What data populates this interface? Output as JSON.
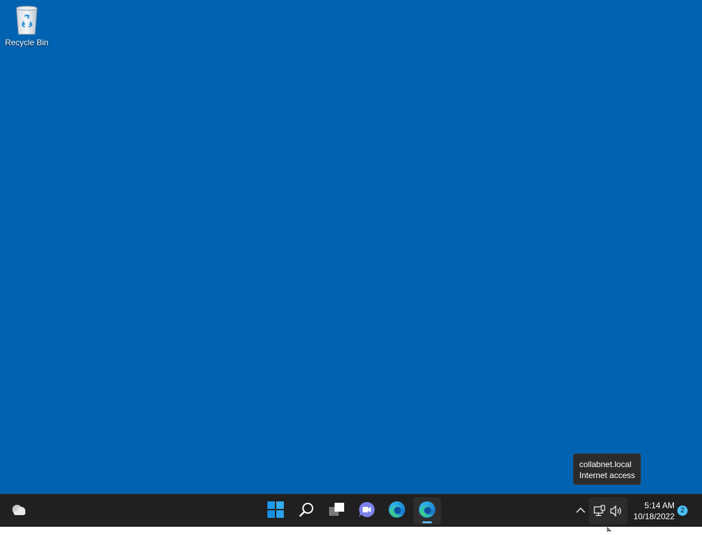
{
  "desktop": {
    "background_color": "#0063b1",
    "icons": [
      {
        "label": "Recycle Bin",
        "icon": "recycle-bin-icon"
      }
    ]
  },
  "tooltip": {
    "line1": "collabnet.local",
    "line2": "Internet access"
  },
  "taskbar": {
    "background_color": "#202020",
    "widgets_icon": "weather-cloud-icon",
    "center_items": [
      {
        "name": "start",
        "icon": "windows-start-icon"
      },
      {
        "name": "search",
        "icon": "search-icon"
      },
      {
        "name": "task-view",
        "icon": "task-view-icon"
      },
      {
        "name": "chat",
        "icon": "teams-chat-icon"
      },
      {
        "name": "edge",
        "icon": "edge-icon"
      },
      {
        "name": "edge-active",
        "icon": "edge-icon",
        "active": true
      }
    ],
    "tray": {
      "overflow_icon": "chevron-up-icon",
      "network_icon": "network-wired-icon",
      "volume_icon": "speaker-icon",
      "time": "5:14 AM",
      "date": "10/18/2022",
      "notification_count": "2",
      "accent_color": "#4cc2ff"
    }
  }
}
